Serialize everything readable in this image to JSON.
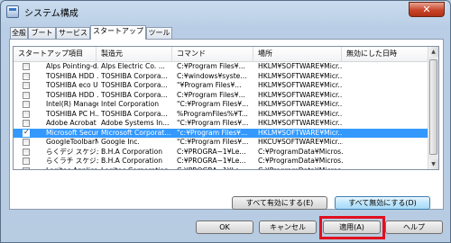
{
  "window": {
    "title": "システム構成",
    "close_label": "✕"
  },
  "tabs": [
    "全般",
    "ブート",
    "サービス",
    "スタートアップ",
    "ツール"
  ],
  "list": {
    "columns": [
      "スタートアップ項目",
      "製造元",
      "コマンド",
      "場所",
      "無効にした日時"
    ],
    "rows": [
      {
        "checked": false,
        "selected": false,
        "cells": [
          "Alps Pointing-d...",
          "Alps Electric Co. ...",
          "C:¥Program Files¥...",
          "HKLM¥SOFTWARE¥Micr...",
          ""
        ]
      },
      {
        "checked": false,
        "selected": false,
        "cells": [
          "TOSHIBA HDD ...",
          "TOSHIBA Corpora...",
          "C:¥windows¥syste...",
          "HKLM¥SOFTWARE¥Micr...",
          ""
        ]
      },
      {
        "checked": false,
        "selected": false,
        "cells": [
          "TOSHIBA eco U...",
          "TOSHIBA Corpora...",
          "\"¥Program Files¥...",
          "HKLM¥SOFTWARE¥Micr...",
          ""
        ]
      },
      {
        "checked": false,
        "selected": false,
        "cells": [
          "TOSHIBA HDD ...",
          "TOSHIBA Corpora...",
          "C:¥Program Files¥...",
          "HKLM¥SOFTWARE¥Micr...",
          ""
        ]
      },
      {
        "checked": false,
        "selected": false,
        "cells": [
          "Intel(R) Manage...",
          "Intel Corporation",
          "\"C:¥Program Files¥...",
          "HKLM¥SOFTWARE¥Micr...",
          ""
        ]
      },
      {
        "checked": false,
        "selected": false,
        "cells": [
          "TOSHIBA PC H...",
          "TOSHIBA Corpora...",
          "%ProgramFiles%¥T...",
          "HKLM¥SOFTWARE¥Micr...",
          ""
        ]
      },
      {
        "checked": false,
        "selected": false,
        "cells": [
          "Adobe Acrobat",
          "Adobe Systems In...",
          "\"C:¥Program Files¥...",
          "HKLM¥SOFTWARE¥Micr...",
          ""
        ]
      },
      {
        "checked": true,
        "selected": true,
        "cells": [
          "Microsoft Securi...",
          "Microsoft Corporat...",
          "\"c:¥Program Files¥...",
          "HKLM¥SOFTWARE¥Micr...",
          ""
        ]
      },
      {
        "checked": false,
        "selected": false,
        "cells": [
          "GoogleToolbarN...",
          "Google Inc.",
          "\"C:¥Program Files¥...",
          "HKCU¥SOFTWARE¥Micr...",
          ""
        ]
      },
      {
        "checked": false,
        "selected": false,
        "cells": [
          "らくデジ スケジュー...",
          "B.H.A Corporation",
          "C:¥PROGRA~1¥Le...",
          "C:¥ProgramData¥Micros...",
          ""
        ]
      },
      {
        "checked": false,
        "selected": false,
        "cells": [
          "らくラチ スケジュー...",
          "B.H.A Corporation",
          "C:¥PROGRA~1¥Le...",
          "C:¥ProgramData¥Micros...",
          ""
        ]
      },
      {
        "checked": false,
        "selected": false,
        "cells": [
          "Logitec Applicat...",
          "Logitec Corporation",
          "C:¥PROGRA~1¥Lo...",
          "C:¥ProgramData¥Micros...",
          ""
        ]
      }
    ]
  },
  "buttons": {
    "enable_all": "すべて有効にする(E)",
    "disable_all": "すべて無効にする(D)",
    "ok": "OK",
    "cancel": "キャンセル",
    "apply": "適用(A)",
    "help": "ヘルプ"
  },
  "colors": {
    "selection": "#3399ff",
    "highlight_box": "#e01020"
  }
}
